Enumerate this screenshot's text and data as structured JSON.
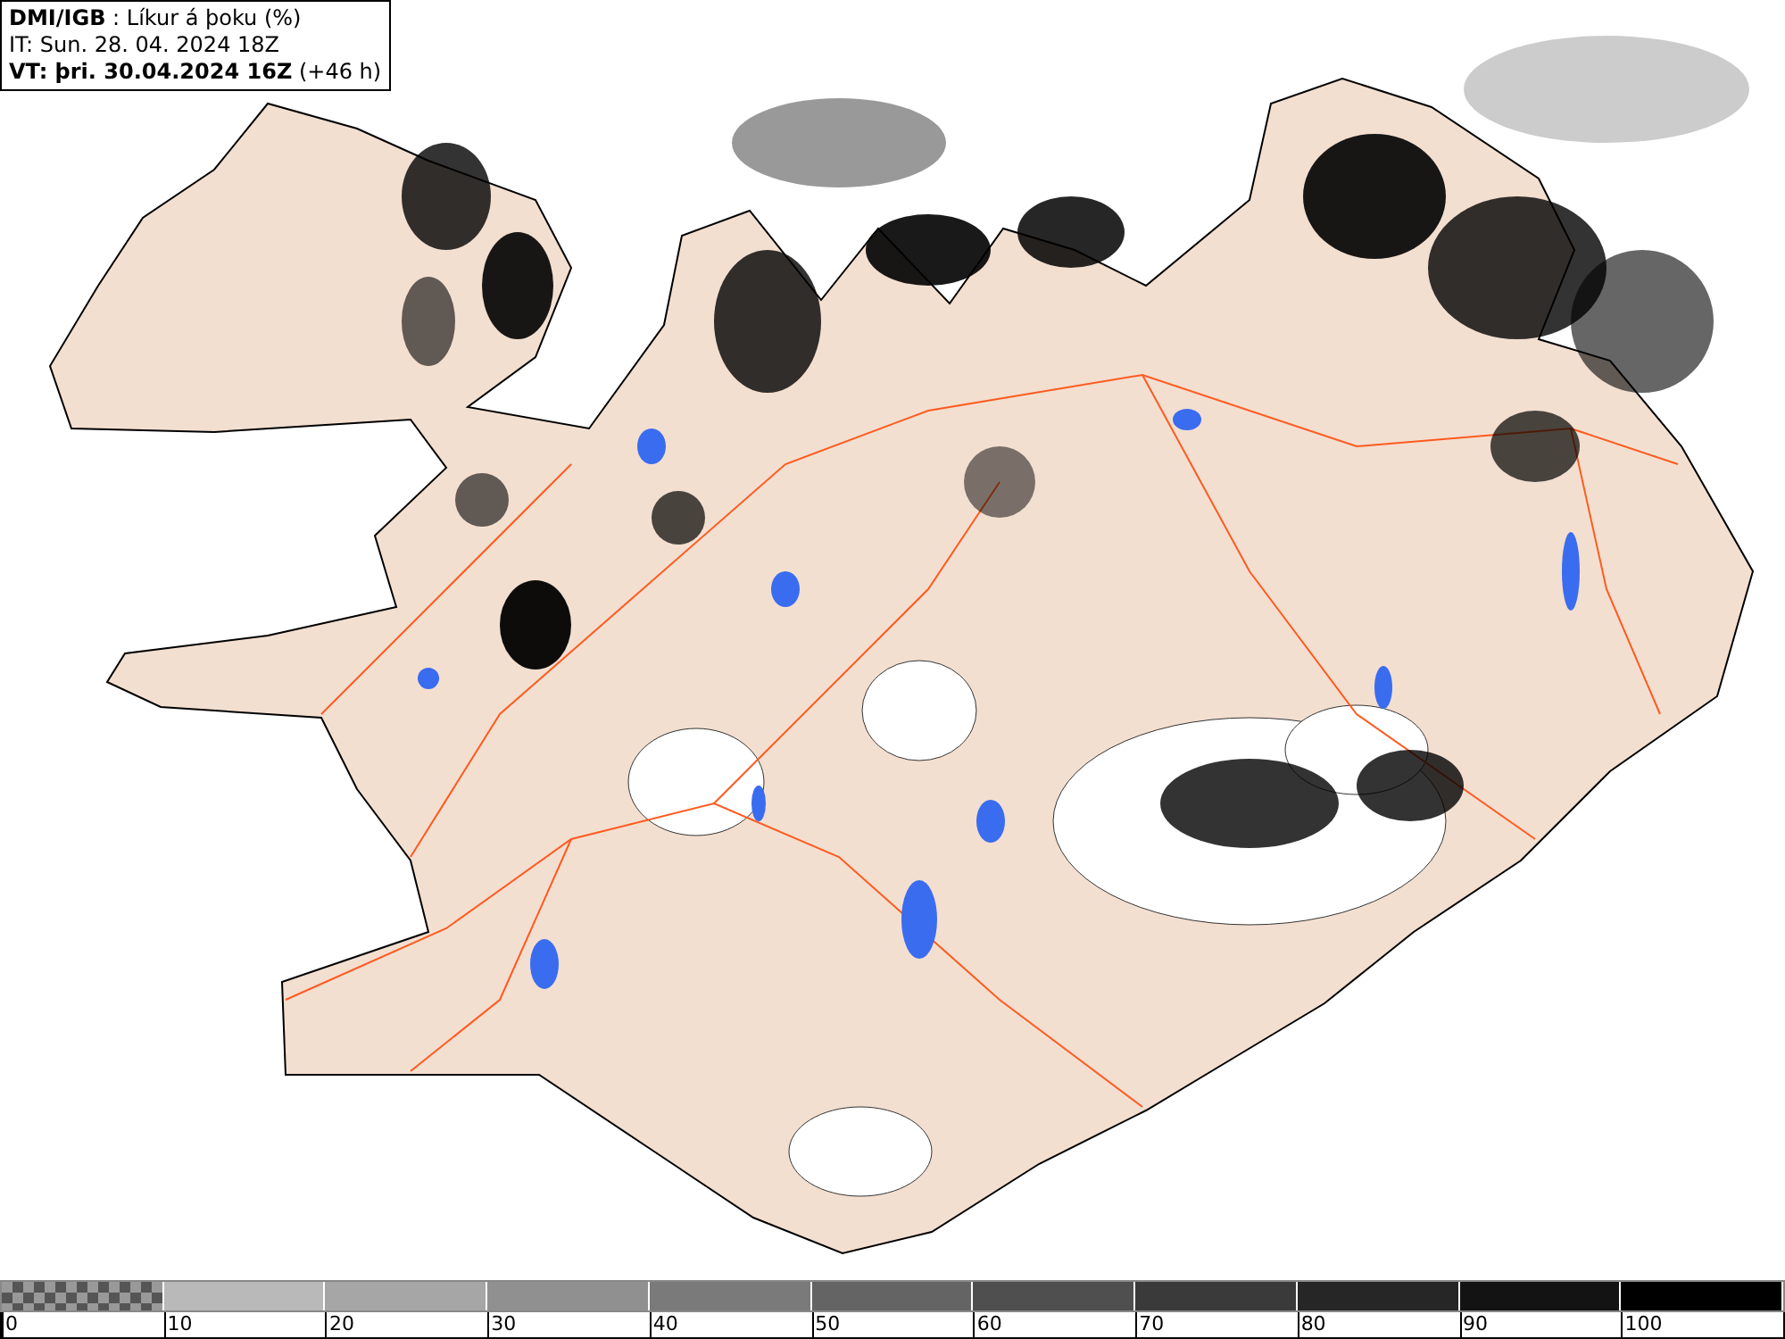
{
  "info": {
    "lines": [
      "**DMI/IGB** : Líkur á þoku (%)",
      "IT: Sun. 28. 04. 2024 18Z",
      "**VT: þri. 30.04.2024 16Z** (+46 h)"
    ]
  },
  "legend": {
    "bins": [
      {
        "kind": "checker"
      },
      {
        "kind": "solid",
        "color": "#b9b9b9"
      },
      {
        "kind": "solid",
        "color": "#a6a6a6"
      },
      {
        "kind": "solid",
        "color": "#909090"
      },
      {
        "kind": "solid",
        "color": "#7a7a7a"
      },
      {
        "kind": "solid",
        "color": "#646464"
      },
      {
        "kind": "solid",
        "color": "#4f4f4f"
      },
      {
        "kind": "solid",
        "color": "#3a3a3a"
      },
      {
        "kind": "solid",
        "color": "#262626"
      },
      {
        "kind": "solid",
        "color": "#131313"
      },
      {
        "kind": "solid",
        "color": "#000000"
      }
    ],
    "labels": [
      "0",
      "10",
      "20",
      "30",
      "40",
      "50",
      "60",
      "70",
      "80",
      "90",
      "100"
    ]
  }
}
